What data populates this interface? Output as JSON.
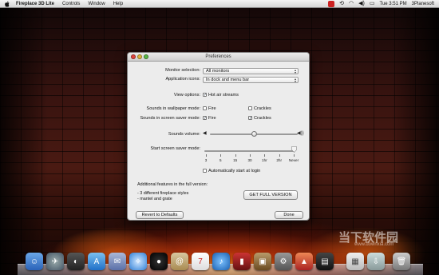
{
  "menubar": {
    "app_name": "Fireplace 3D Lite",
    "menus": [
      "Controls",
      "Window",
      "Help"
    ],
    "clock": "Tue 3:51 PM",
    "user": "3Planesoft"
  },
  "dialog": {
    "title": "Preferences",
    "monitor_selection_label": "Monitor selection:",
    "monitor_selection_value": "All monitors",
    "application_icons_label": "Application icons:",
    "application_icons_value": "In dock and menu bar",
    "view_options_label": "View options:",
    "hot_air_label": "Hot air streams",
    "hot_air_checked": true,
    "sounds_wallpaper_label": "Sounds in wallpaper mode:",
    "sounds_screensaver_label": "Sounds in screen saver mode:",
    "fire_label": "Fire",
    "crackles_label": "Crackles",
    "wallpaper_fire_checked": false,
    "wallpaper_crackles_checked": false,
    "screensaver_fire_checked": true,
    "screensaver_crackles_checked": true,
    "sounds_volume_label": "Sounds volume:",
    "volume_level": 0.5,
    "start_screensaver_label": "Start screen saver mode:",
    "screensaver_ticks": [
      "3",
      "5",
      "15",
      "30",
      "1hr",
      "2hr",
      "Never"
    ],
    "screensaver_selected": "Never",
    "auto_start_label": "Automatically start at login",
    "auto_start_checked": false,
    "full_version_heading": "Additional features in the full version:",
    "full_version_features": [
      "- 3 different fireplace styles",
      "- mantel and grate"
    ],
    "get_full_version_label": "GET FULL VERSION",
    "revert_label": "Revert to Defaults",
    "done_label": "Done"
  },
  "watermark": {
    "text": "当下软件园",
    "url": "www.downxia.com"
  },
  "colors": {
    "accent": "#3b7bd8",
    "dialog_bg": "#ececec"
  }
}
